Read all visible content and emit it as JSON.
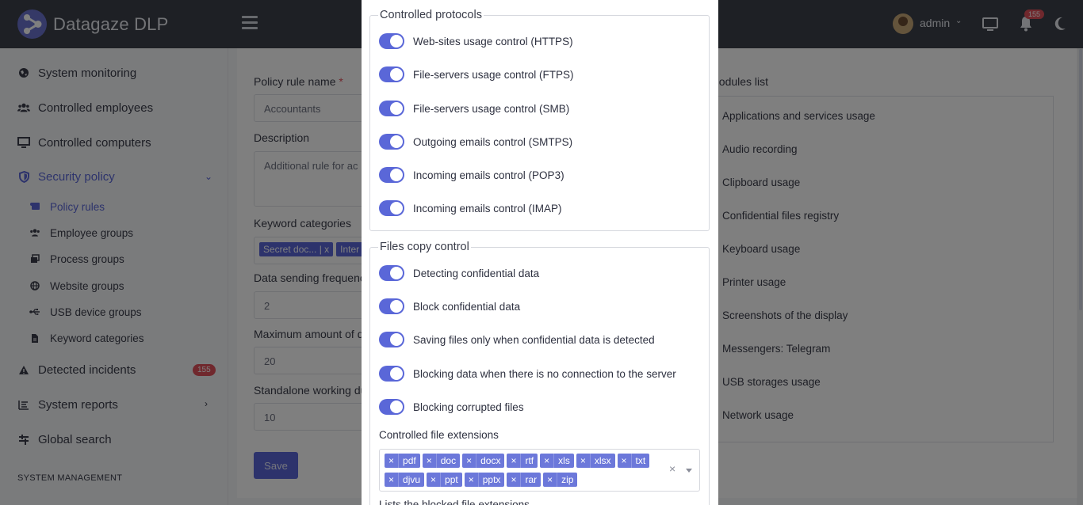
{
  "app": {
    "title": "Datagaze DLP"
  },
  "header": {
    "user": "admin",
    "notifications_count": "155",
    "icons": [
      "monitor-icon",
      "bell-icon",
      "moon-icon"
    ]
  },
  "sidebar": {
    "items": [
      {
        "label": "System monitoring",
        "icon": "globe-icon"
      },
      {
        "label": "Controlled employees",
        "icon": "users-icon"
      },
      {
        "label": "Controlled computers",
        "icon": "desktop-icon"
      },
      {
        "label": "Security policy",
        "icon": "shield-icon"
      },
      {
        "label": "Detected incidents",
        "icon": "warning-icon",
        "badge": "155"
      },
      {
        "label": "System reports",
        "icon": "list-icon"
      },
      {
        "label": "Global search",
        "icon": "search-filter-icon"
      }
    ],
    "sub_items": [
      {
        "label": "Policy rules"
      },
      {
        "label": "Employee groups"
      },
      {
        "label": "Process groups"
      },
      {
        "label": "Website groups"
      },
      {
        "label": "USB device groups"
      },
      {
        "label": "Keyword categories"
      }
    ],
    "section_title": "SYSTEM MANAGEMENT"
  },
  "form": {
    "policy_rule_name_label": "Policy rule name",
    "policy_rule_name_required": "*",
    "policy_rule_name_value": "Accountants",
    "description_label": "Description",
    "description_value": "Additional rule for ac",
    "keyword_categories_label": "Keyword categories",
    "keyword_tags": [
      "Secret doc... | x",
      "Inter"
    ],
    "data_sending_label": "Data sending frequenc",
    "data_sending_value": "2",
    "max_amount_label": "Maximum amount of d",
    "max_amount_value": "20",
    "standalone_label": "Standalone working du",
    "standalone_value": "10",
    "save_label": "Save"
  },
  "modules": {
    "title": "nodules list",
    "items": [
      "Applications and services usage",
      "Audio recording",
      "Clipboard usage",
      "Confidential files registry",
      "Keyboard usage",
      "Printer usage",
      "Screenshots of the display",
      "Messengers: Telegram",
      "USB storages usage",
      "Network usage"
    ]
  },
  "modal": {
    "protocols": {
      "legend": "Controlled protocols",
      "items": [
        {
          "label": "Web-sites usage control (HTTPS)",
          "on": true
        },
        {
          "label": "File-servers usage control (FTPS)",
          "on": true
        },
        {
          "label": "File-servers usage control (SMB)",
          "on": true
        },
        {
          "label": "Outgoing emails control (SMTPS)",
          "on": true
        },
        {
          "label": "Incoming emails control (POP3)",
          "on": true
        },
        {
          "label": "Incoming emails control (IMAP)",
          "on": true
        }
      ]
    },
    "files_copy": {
      "legend": "Files copy control",
      "items": [
        {
          "label": "Detecting confidential data",
          "on": true
        },
        {
          "label": "Block confidential data",
          "on": true
        },
        {
          "label": "Saving files only when confidential data is detected",
          "on": true
        },
        {
          "label": "Blocking data when there is no connection to the server",
          "on": true
        },
        {
          "label": "Blocking corrupted files",
          "on": true
        }
      ],
      "extensions_label": "Controlled file extensions",
      "extensions": [
        "pdf",
        "doc",
        "docx",
        "rtf",
        "xls",
        "xlsx",
        "txt",
        "djvu",
        "ppt",
        "pptx",
        "rar",
        "zip"
      ],
      "next_label": "Lists the blocked file extensions"
    }
  },
  "colors": {
    "accent": "#5a67d8",
    "topbar": "#3d414a",
    "badge": "#e0515b"
  }
}
